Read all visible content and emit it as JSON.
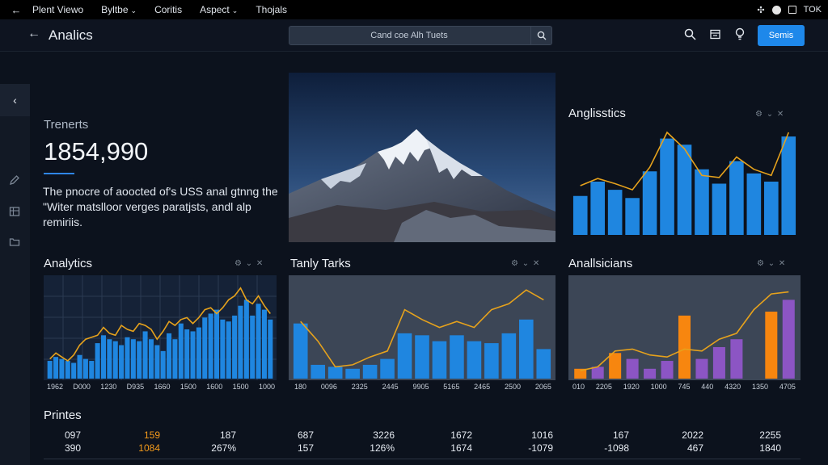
{
  "menubar": {
    "back_icon": "arrow-left-icon",
    "items": [
      "Plent Viewo",
      "Byltbe",
      "Coritis",
      "Aspect",
      "Thojals"
    ],
    "status_text": "TOK"
  },
  "appbar": {
    "title": "Analics",
    "search_placeholder": "Cand coe Alh Tuets",
    "primary_button": "Semis"
  },
  "trend": {
    "label": "Trenerts",
    "value": "1854,990",
    "description": "The pnocre of aoocted of's USS anal gtnng the \"Witer matslloor verges paratjsts, andl alp remiriis."
  },
  "panels": {
    "top_right_title": "Anglisstics",
    "left_title": "Analytics",
    "mid_title": "Tanly Tarks",
    "right_title": "Anallsicians",
    "tools": "⚙ ⌄ ✕"
  },
  "colors": {
    "blue": "#1f86e0",
    "orange_line": "#e6a21c",
    "orange_bar": "#f7860f",
    "purple": "#8c55c4",
    "accent": "#1e88ea"
  },
  "axes": {
    "left": [
      "1962",
      "D000",
      "1230",
      "D935",
      "1660",
      "1500",
      "1600",
      "1500",
      "1000"
    ],
    "mid": [
      "180",
      "0096",
      "2325",
      "2445",
      "9905",
      "5165",
      "2465",
      "2500",
      "2065"
    ],
    "right": [
      "010",
      "2205",
      "1920",
      "1000",
      "745",
      "440",
      "4320",
      "1350",
      "4705"
    ]
  },
  "chart_data": [
    {
      "type": "bar",
      "title": "Anglisstics",
      "values": [
        38,
        52,
        44,
        36,
        62,
        94,
        88,
        64,
        50,
        72,
        60,
        52,
        96
      ],
      "line": [
        48,
        55,
        50,
        44,
        66,
        100,
        84,
        58,
        56,
        76,
        64,
        58,
        100
      ],
      "ylim": [
        0,
        100
      ]
    },
    {
      "type": "bar",
      "title": "Analytics",
      "values": [
        18,
        22,
        20,
        18,
        16,
        24,
        20,
        18,
        36,
        44,
        40,
        38,
        34,
        42,
        40,
        38,
        48,
        40,
        34,
        28,
        46,
        40,
        56,
        50,
        48,
        52,
        62,
        66,
        70,
        60,
        58,
        64,
        74,
        80,
        64,
        76,
        70,
        60
      ],
      "line": [
        20,
        26,
        22,
        18,
        24,
        34,
        40,
        42,
        44,
        52,
        46,
        44,
        54,
        50,
        48,
        56,
        54,
        50,
        40,
        48,
        58,
        54,
        60,
        62,
        56,
        62,
        70,
        72,
        66,
        72,
        80,
        84,
        92,
        80,
        76,
        84,
        74,
        66
      ],
      "ylim": [
        0,
        100
      ]
    },
    {
      "type": "bar",
      "title": "Tanly Tarks",
      "values": [
        56,
        14,
        12,
        10,
        14,
        20,
        46,
        44,
        38,
        44,
        38,
        36,
        46,
        60,
        30
      ],
      "line": [
        58,
        38,
        12,
        14,
        22,
        28,
        70,
        60,
        52,
        58,
        52,
        70,
        76,
        90,
        80
      ],
      "ylim": [
        0,
        100
      ]
    },
    {
      "type": "bar",
      "title": "Anallsicians",
      "series": [
        {
          "name": "",
          "color": "orange",
          "values": [
            10,
            0,
            26,
            0,
            0,
            0,
            64,
            0,
            0,
            0,
            0,
            68,
            0
          ]
        },
        {
          "name": "",
          "color": "purple",
          "values": [
            0,
            12,
            0,
            20,
            10,
            18,
            0,
            20,
            32,
            40,
            0,
            0,
            80
          ]
        }
      ],
      "line": [
        8,
        12,
        28,
        30,
        24,
        22,
        30,
        28,
        40,
        46,
        70,
        86,
        88
      ],
      "ylim": [
        0,
        100
      ]
    }
  ],
  "table": {
    "title": "Printes",
    "rows": [
      [
        "097",
        "159",
        "187",
        "687",
        "3226",
        "1672",
        "1016",
        "167",
        "2022",
        "2255"
      ],
      [
        "390",
        "1084",
        "267%",
        "157",
        "126%",
        "1674",
        "-1079",
        "-1098",
        "467",
        "1840"
      ]
    ],
    "highlight_column": 1
  }
}
